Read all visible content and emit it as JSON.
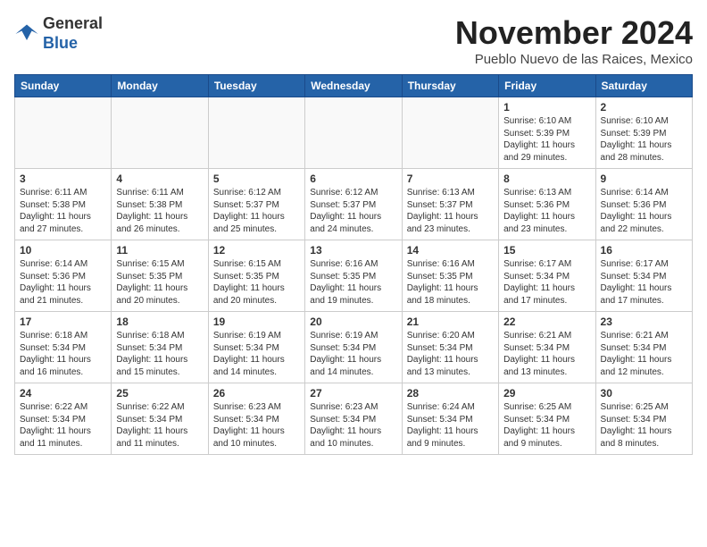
{
  "header": {
    "logo_general": "General",
    "logo_blue": "Blue",
    "month_title": "November 2024",
    "location": "Pueblo Nuevo de las Raices, Mexico"
  },
  "weekdays": [
    "Sunday",
    "Monday",
    "Tuesday",
    "Wednesday",
    "Thursday",
    "Friday",
    "Saturday"
  ],
  "weeks": [
    [
      {
        "day": "",
        "content": ""
      },
      {
        "day": "",
        "content": ""
      },
      {
        "day": "",
        "content": ""
      },
      {
        "day": "",
        "content": ""
      },
      {
        "day": "",
        "content": ""
      },
      {
        "day": "1",
        "content": "Sunrise: 6:10 AM\nSunset: 5:39 PM\nDaylight: 11 hours\nand 29 minutes."
      },
      {
        "day": "2",
        "content": "Sunrise: 6:10 AM\nSunset: 5:39 PM\nDaylight: 11 hours\nand 28 minutes."
      }
    ],
    [
      {
        "day": "3",
        "content": "Sunrise: 6:11 AM\nSunset: 5:38 PM\nDaylight: 11 hours\nand 27 minutes."
      },
      {
        "day": "4",
        "content": "Sunrise: 6:11 AM\nSunset: 5:38 PM\nDaylight: 11 hours\nand 26 minutes."
      },
      {
        "day": "5",
        "content": "Sunrise: 6:12 AM\nSunset: 5:37 PM\nDaylight: 11 hours\nand 25 minutes."
      },
      {
        "day": "6",
        "content": "Sunrise: 6:12 AM\nSunset: 5:37 PM\nDaylight: 11 hours\nand 24 minutes."
      },
      {
        "day": "7",
        "content": "Sunrise: 6:13 AM\nSunset: 5:37 PM\nDaylight: 11 hours\nand 23 minutes."
      },
      {
        "day": "8",
        "content": "Sunrise: 6:13 AM\nSunset: 5:36 PM\nDaylight: 11 hours\nand 23 minutes."
      },
      {
        "day": "9",
        "content": "Sunrise: 6:14 AM\nSunset: 5:36 PM\nDaylight: 11 hours\nand 22 minutes."
      }
    ],
    [
      {
        "day": "10",
        "content": "Sunrise: 6:14 AM\nSunset: 5:36 PM\nDaylight: 11 hours\nand 21 minutes."
      },
      {
        "day": "11",
        "content": "Sunrise: 6:15 AM\nSunset: 5:35 PM\nDaylight: 11 hours\nand 20 minutes."
      },
      {
        "day": "12",
        "content": "Sunrise: 6:15 AM\nSunset: 5:35 PM\nDaylight: 11 hours\nand 20 minutes."
      },
      {
        "day": "13",
        "content": "Sunrise: 6:16 AM\nSunset: 5:35 PM\nDaylight: 11 hours\nand 19 minutes."
      },
      {
        "day": "14",
        "content": "Sunrise: 6:16 AM\nSunset: 5:35 PM\nDaylight: 11 hours\nand 18 minutes."
      },
      {
        "day": "15",
        "content": "Sunrise: 6:17 AM\nSunset: 5:34 PM\nDaylight: 11 hours\nand 17 minutes."
      },
      {
        "day": "16",
        "content": "Sunrise: 6:17 AM\nSunset: 5:34 PM\nDaylight: 11 hours\nand 17 minutes."
      }
    ],
    [
      {
        "day": "17",
        "content": "Sunrise: 6:18 AM\nSunset: 5:34 PM\nDaylight: 11 hours\nand 16 minutes."
      },
      {
        "day": "18",
        "content": "Sunrise: 6:18 AM\nSunset: 5:34 PM\nDaylight: 11 hours\nand 15 minutes."
      },
      {
        "day": "19",
        "content": "Sunrise: 6:19 AM\nSunset: 5:34 PM\nDaylight: 11 hours\nand 14 minutes."
      },
      {
        "day": "20",
        "content": "Sunrise: 6:19 AM\nSunset: 5:34 PM\nDaylight: 11 hours\nand 14 minutes."
      },
      {
        "day": "21",
        "content": "Sunrise: 6:20 AM\nSunset: 5:34 PM\nDaylight: 11 hours\nand 13 minutes."
      },
      {
        "day": "22",
        "content": "Sunrise: 6:21 AM\nSunset: 5:34 PM\nDaylight: 11 hours\nand 13 minutes."
      },
      {
        "day": "23",
        "content": "Sunrise: 6:21 AM\nSunset: 5:34 PM\nDaylight: 11 hours\nand 12 minutes."
      }
    ],
    [
      {
        "day": "24",
        "content": "Sunrise: 6:22 AM\nSunset: 5:34 PM\nDaylight: 11 hours\nand 11 minutes."
      },
      {
        "day": "25",
        "content": "Sunrise: 6:22 AM\nSunset: 5:34 PM\nDaylight: 11 hours\nand 11 minutes."
      },
      {
        "day": "26",
        "content": "Sunrise: 6:23 AM\nSunset: 5:34 PM\nDaylight: 11 hours\nand 10 minutes."
      },
      {
        "day": "27",
        "content": "Sunrise: 6:23 AM\nSunset: 5:34 PM\nDaylight: 11 hours\nand 10 minutes."
      },
      {
        "day": "28",
        "content": "Sunrise: 6:24 AM\nSunset: 5:34 PM\nDaylight: 11 hours\nand 9 minutes."
      },
      {
        "day": "29",
        "content": "Sunrise: 6:25 AM\nSunset: 5:34 PM\nDaylight: 11 hours\nand 9 minutes."
      },
      {
        "day": "30",
        "content": "Sunrise: 6:25 AM\nSunset: 5:34 PM\nDaylight: 11 hours\nand 8 minutes."
      }
    ]
  ]
}
